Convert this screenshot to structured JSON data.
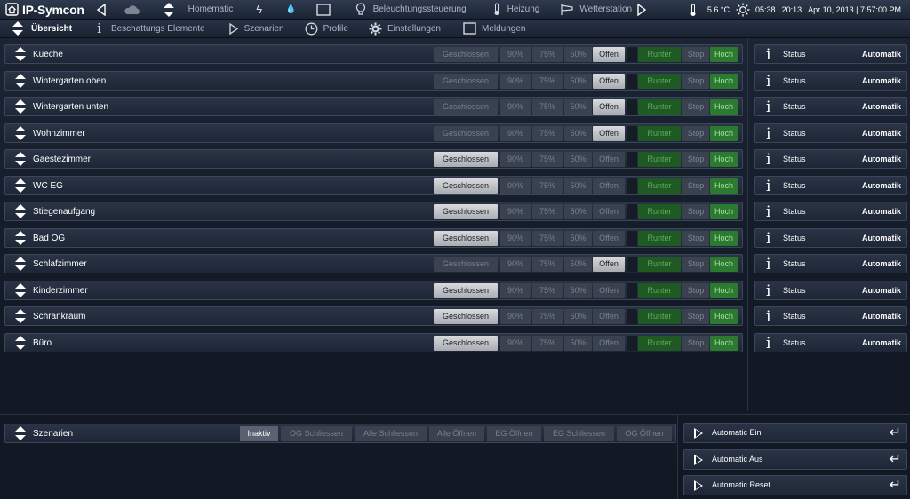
{
  "topbar": {
    "app_title": "IP-Symcon",
    "items": [
      "Homematic",
      "Beleuchtungssteuerung",
      "Heizung",
      "Wetterstation"
    ],
    "temperature": "5.6 °C",
    "sunrise": "05:38",
    "sunset": "20:13",
    "datetime": "Apr 10, 2013 | 7:57:00 PM"
  },
  "nav": {
    "items": [
      "Übersicht",
      "Beschattungs Elemente",
      "Szenarien",
      "Profile",
      "Einstellungen",
      "Meldungen"
    ]
  },
  "shade_buttons": {
    "closed": "Geschlossen",
    "p90": "90%",
    "p75": "75%",
    "p50": "50%",
    "open": "Offen",
    "down": "Runter",
    "stop": "Stop",
    "up": "Hoch"
  },
  "rooms": [
    {
      "name": "Kueche",
      "state": "Offen",
      "motion": "Hoch"
    },
    {
      "name": "Wintergarten oben",
      "state": "Offen",
      "motion": "Hoch"
    },
    {
      "name": "Wintergarten unten",
      "state": "Offen",
      "motion": "Hoch"
    },
    {
      "name": "Wohnzimmer",
      "state": "Offen",
      "motion": "Hoch"
    },
    {
      "name": "Gaestezimmer",
      "state": "Geschlossen",
      "motion": "Hoch"
    },
    {
      "name": "WC EG",
      "state": "Geschlossen",
      "motion": "Hoch"
    },
    {
      "name": "Stiegenaufgang",
      "state": "Geschlossen",
      "motion": "Hoch"
    },
    {
      "name": "Bad OG",
      "state": "Geschlossen",
      "motion": "Hoch"
    },
    {
      "name": "Schlafzimmer",
      "state": "Offen",
      "motion": "Hoch"
    },
    {
      "name": "Kinderzimmer",
      "state": "Geschlossen",
      "motion": "Hoch"
    },
    {
      "name": "Schrankraum",
      "state": "Geschlossen",
      "motion": "Hoch"
    },
    {
      "name": "Büro",
      "state": "Geschlossen",
      "motion": "Hoch"
    }
  ],
  "status": {
    "label": "Status",
    "value": "Automatik"
  },
  "scenarios": {
    "label": "Szenarien",
    "buttons": [
      "Inaktiv",
      "OG Schliessen",
      "Alle Schliessen",
      "Alle Öffnen",
      "EG Öffnen",
      "EG Schliessen",
      "OG Öffnen"
    ],
    "active": "Inaktiv"
  },
  "automatic": [
    "Automatic Ein",
    "Automatic Aus",
    "Automatic Reset"
  ],
  "colors": {
    "accent_green": "#2b7a30",
    "active_button": "#c8cacd",
    "background": "#131a26"
  }
}
